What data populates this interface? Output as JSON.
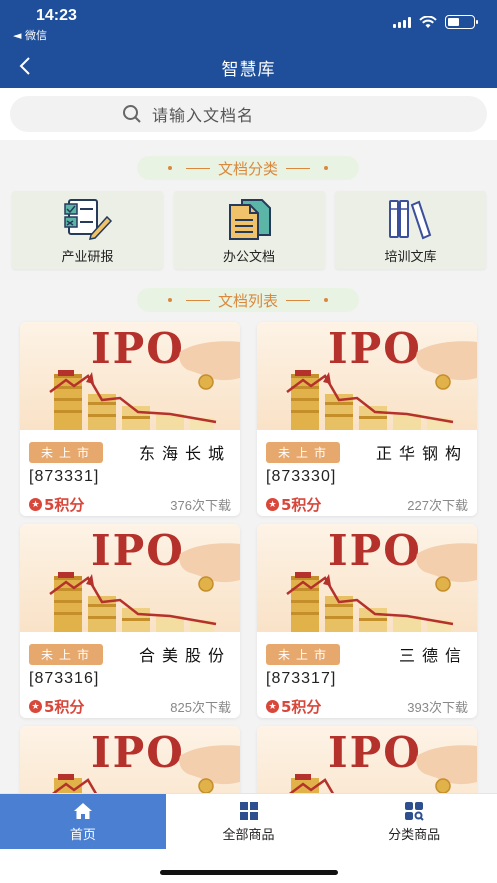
{
  "status": {
    "time": "14:23",
    "back_app": "◄ 微信"
  },
  "nav": {
    "title": "智慧库"
  },
  "search": {
    "placeholder": "请输入文档名"
  },
  "sections": {
    "categories_title": "文档分类",
    "list_title": "文档列表"
  },
  "categories": [
    {
      "label": "产业研报",
      "icon": "report-icon"
    },
    {
      "label": "办公文档",
      "icon": "document-icon"
    },
    {
      "label": "培训文库",
      "icon": "books-icon"
    }
  ],
  "docs": [
    {
      "thumb_text": "IPO",
      "badge": "未上市",
      "name": "东海长城",
      "code": "[873331]",
      "points": "5积分",
      "downloads": "376次下载"
    },
    {
      "thumb_text": "IPO",
      "badge": "未上市",
      "name": "正华钢构",
      "code": "[873330]",
      "points": "5积分",
      "downloads": "227次下载"
    },
    {
      "thumb_text": "IPO",
      "badge": "未上市",
      "name": "合美股份",
      "code": "[873316]",
      "points": "5积分",
      "downloads": "825次下载"
    },
    {
      "thumb_text": "IPO",
      "badge": "未上市",
      "name": "三德信",
      "code": "[873317]",
      "points": "5积分",
      "downloads": "393次下载"
    },
    {
      "thumb_text": "IPO"
    },
    {
      "thumb_text": "IPO"
    }
  ],
  "tabs": [
    {
      "label": "首页",
      "icon": "home-icon",
      "active": true
    },
    {
      "label": "全部商品",
      "icon": "grid-icon",
      "active": false
    },
    {
      "label": "分类商品",
      "icon": "category-search-icon",
      "active": false
    }
  ],
  "colors": {
    "header": "#1f4f9a",
    "accent": "#d9883c",
    "badge": "#e7a86d",
    "points": "#d9473b",
    "tab_active": "#4a7fd1"
  }
}
